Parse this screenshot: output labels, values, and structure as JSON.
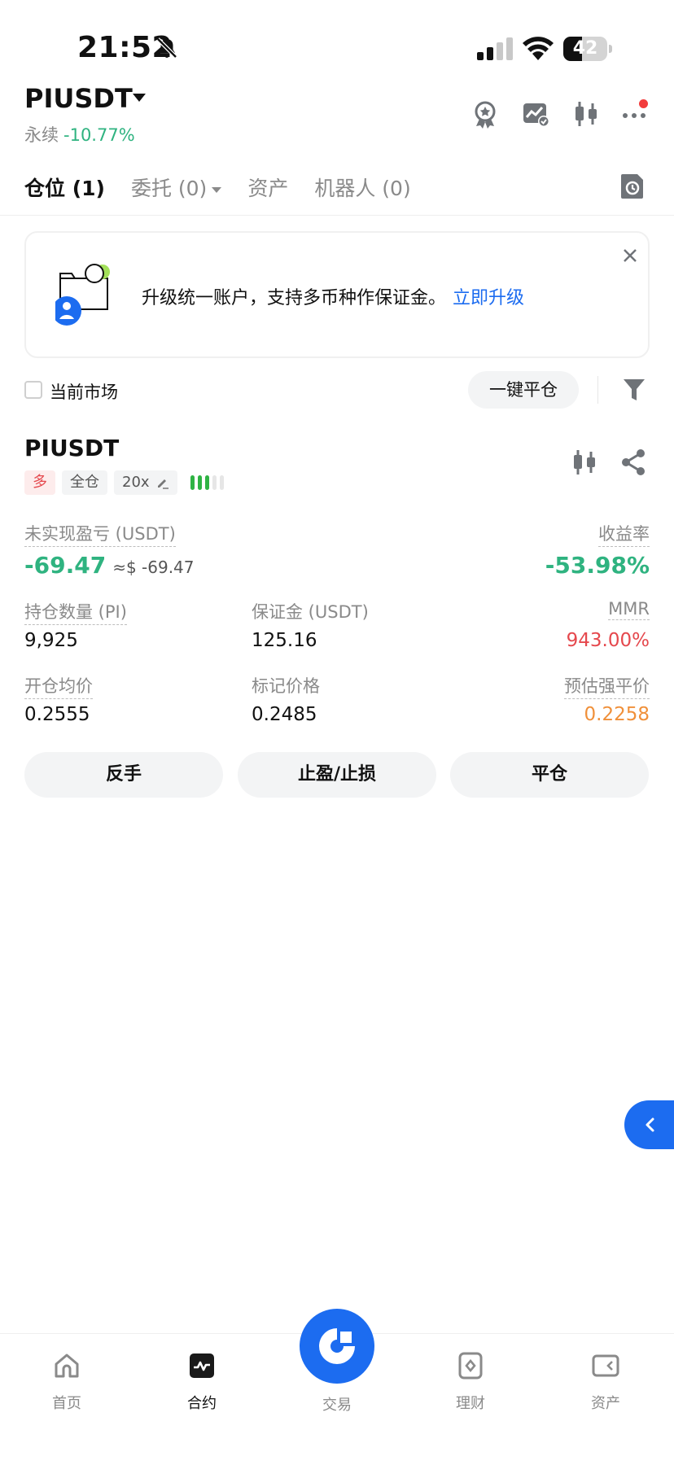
{
  "status_bar": {
    "time": "21:52",
    "battery_level": "42",
    "battery_fraction": 0.42
  },
  "header": {
    "symbol": "PIUSDT",
    "contract_type": "永续",
    "change": "-10.77%",
    "icons": [
      "badge-icon",
      "chart-check-icon",
      "candlestick-icon",
      "more-icon"
    ]
  },
  "tabs": [
    {
      "label": "仓位 (1)",
      "active": true
    },
    {
      "label": "委托 (0)",
      "active": false
    },
    {
      "label": "资产",
      "active": false
    },
    {
      "label": "机器人 (0)",
      "active": false
    }
  ],
  "banner": {
    "text": "升级统一账户，支持多币种作保证金。",
    "link": "立即升级"
  },
  "filter": {
    "checkbox_label": "当前市场",
    "close_all": "一键平仓"
  },
  "position": {
    "symbol": "PIUSDT",
    "side": "多",
    "margin_mode": "全仓",
    "leverage": "20x",
    "risk_level": 3,
    "risk_total": 5,
    "unrealized_pnl_label": "未实现盈亏 (USDT)",
    "unrealized_pnl": "-69.47",
    "unrealized_pnl_usd": "≈$ -69.47",
    "roe_label": "收益率",
    "roe": "-53.98%",
    "size_label": "持仓数量 (PI)",
    "size": "9,925",
    "margin_label": "保证金 (USDT)",
    "margin": "125.16",
    "mmr_label": "MMR",
    "mmr": "943.00%",
    "entry_label": "开仓均价",
    "entry": "0.2555",
    "mark_label": "标记价格",
    "mark": "0.2485",
    "liq_label": "预估强平价",
    "liq": "0.2258"
  },
  "actions": {
    "reverse": "反手",
    "tp_sl": "止盈/止损",
    "close": "平仓"
  },
  "bottom_nav": {
    "home": "首页",
    "futures": "合约",
    "trade": "交易",
    "earn": "理财",
    "assets": "资产"
  },
  "colors": {
    "accent": "#1c6cf0",
    "green": "#2fb380",
    "red": "#e5484d",
    "orange": "#f0903a"
  }
}
